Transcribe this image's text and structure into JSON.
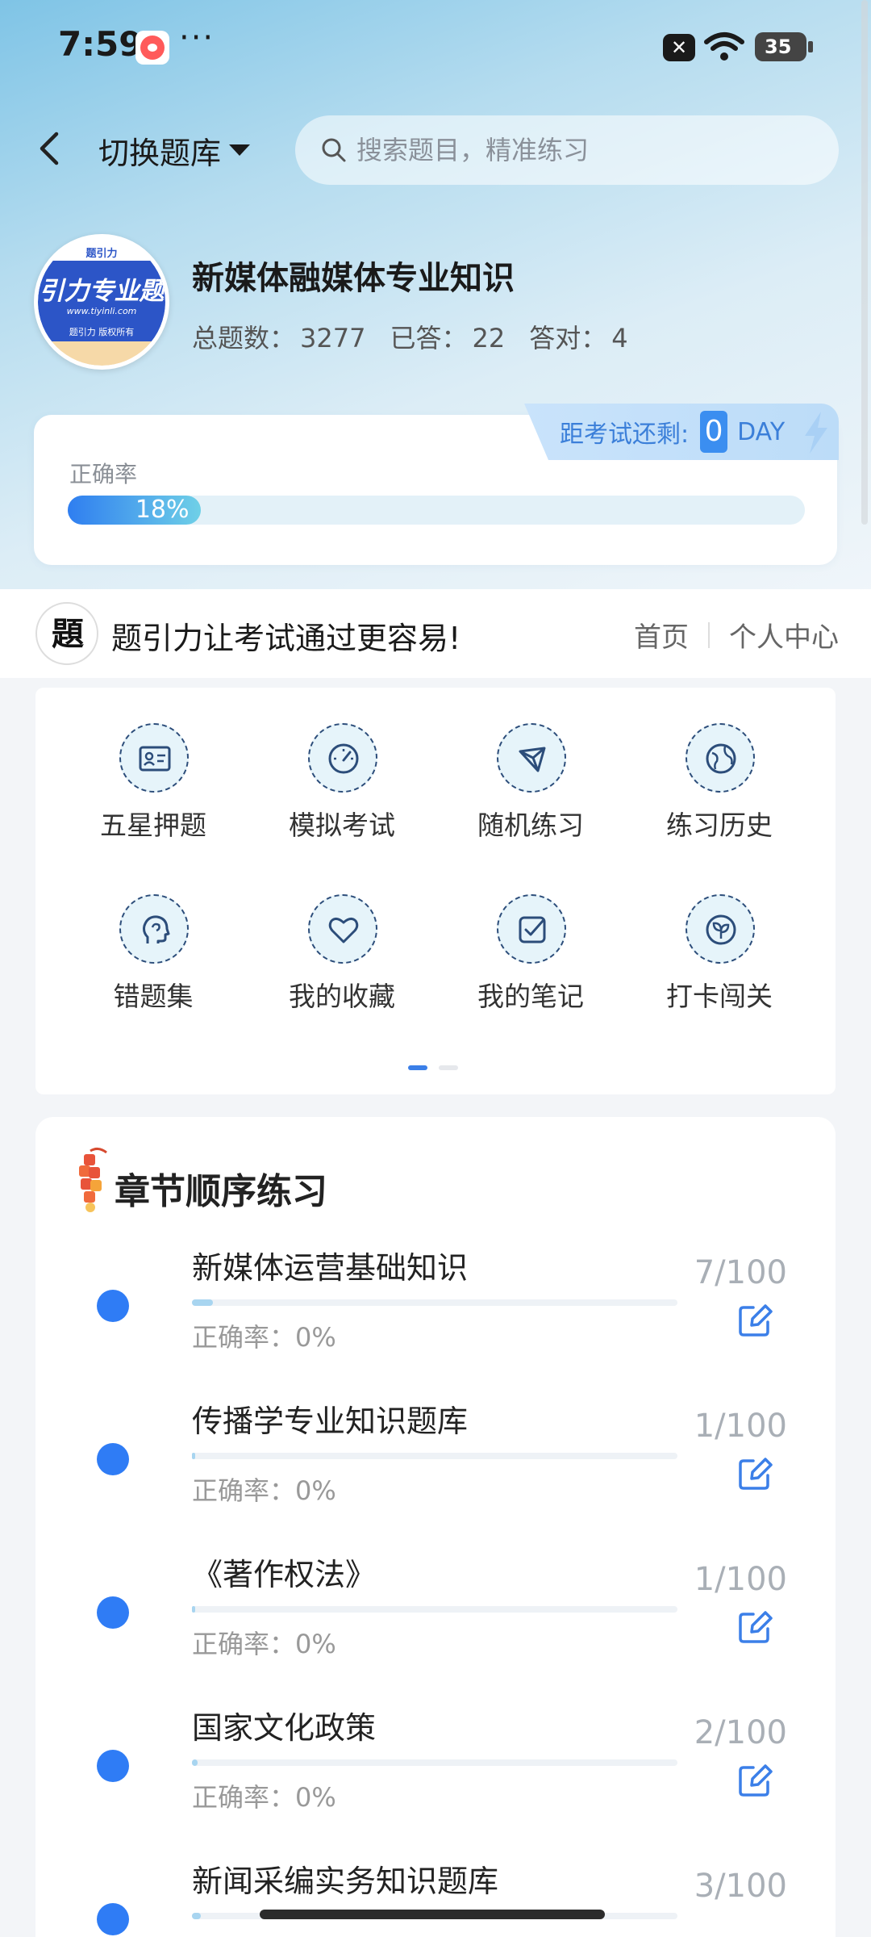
{
  "status": {
    "time": "7:59",
    "more": "···",
    "battery": "35"
  },
  "header": {
    "switch_label": "切换题库",
    "search_placeholder": "搜索题目，精准练习"
  },
  "bank": {
    "logo_text": "引力专业题",
    "logo_url": "www.tiyinli.com",
    "logo_copyright": "题引力 版权所有",
    "title": "新媒体融媒体专业知识",
    "total_label": "总题数：",
    "total": "3277",
    "answered_label": "已答：",
    "answered": "22",
    "correct_label": "答对：",
    "correct": "4"
  },
  "accuracy": {
    "label": "正确率",
    "value_text": "18%",
    "value": 0.18,
    "countdown_label": "距考试还剩:",
    "countdown_num": "0",
    "countdown_unit": "DAY"
  },
  "brand": {
    "slogan": "题引力让考试通过更容易!",
    "nav_home": "首页",
    "nav_profile": "个人中心"
  },
  "menu": {
    "items": [
      {
        "label": "五星押题",
        "icon": "id-card-icon"
      },
      {
        "label": "模拟考试",
        "icon": "gauge-icon"
      },
      {
        "label": "随机练习",
        "icon": "network-icon"
      },
      {
        "label": "练习历史",
        "icon": "globe-icon"
      },
      {
        "label": "错题集",
        "icon": "head-icon"
      },
      {
        "label": "我的收藏",
        "icon": "heart-icon"
      },
      {
        "label": "我的笔记",
        "icon": "checkbox-icon"
      },
      {
        "label": "打卡闯关",
        "icon": "plant-icon"
      }
    ]
  },
  "chapters": {
    "title": "章节顺序练习",
    "acc_label": "正确率：",
    "items": [
      {
        "name": "新媒体运营基础知识",
        "acc": "0%",
        "count": "7/100",
        "progress": 0.07
      },
      {
        "name": "传播学专业知识题库",
        "acc": "0%",
        "count": "1/100",
        "progress": 0.01
      },
      {
        "name": "《著作权法》",
        "acc": "0%",
        "count": "1/100",
        "progress": 0.01
      },
      {
        "name": "国家文化政策",
        "acc": "0%",
        "count": "2/100",
        "progress": 0.02
      },
      {
        "name": "新闻采编实务知识题库",
        "acc": "",
        "count": "3/100",
        "progress": 0.03
      }
    ]
  },
  "colors": {
    "accent": "#2f7cf5",
    "icon_stroke": "#2c4d7a",
    "icon_bg": "#e6f4fa"
  }
}
